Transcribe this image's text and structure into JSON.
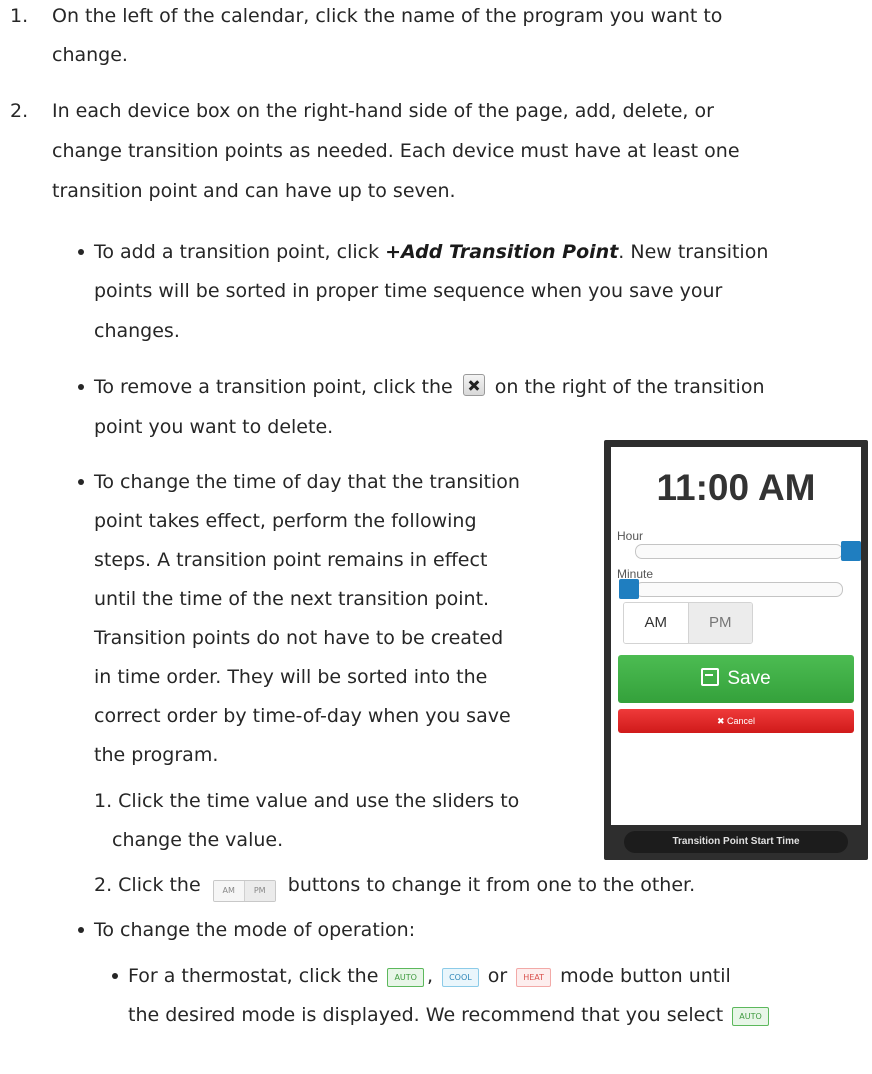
{
  "step1": {
    "number": "1.",
    "line1": "On the left of the calendar, click the name of the program you want to",
    "line2": "change."
  },
  "step2": {
    "number": "2.",
    "line1": "In each device box on the right-hand side of the page, add, delete, or",
    "line2": "change transition points as needed. Each device must have at least one",
    "line3": "transition point and can have up to seven."
  },
  "bullet_add": {
    "pre": "To add a transition point, click ",
    "emph": "+Add Transition Point",
    "post": ". New transition",
    "line2": "points will be sorted in proper time sequence when you save your",
    "line3": "changes."
  },
  "bullet_remove": {
    "pre": "To remove a transition point, click the",
    "post": "on the right of the transition",
    "line2": "point you want to delete."
  },
  "bullet_time": {
    "line1": "To change the time of day that the transition",
    "line2": "point takes effect, perform the following",
    "line3": "steps. A transition point remains in effect",
    "line4": "until the time of the next transition point.",
    "line5": "Transition points do not have to be created",
    "line6": "in time order. They will be sorted into the",
    "line7": "correct order by time-of-day when you save",
    "line8": "the program."
  },
  "substep1": {
    "line1": "1. Click the time value and use the sliders to",
    "line2": "change the value."
  },
  "substep2": {
    "pre": "2. Click the",
    "am": "AM",
    "pm": "PM",
    "post": "buttons to change it from one to the other."
  },
  "bullet_mode": {
    "line1": "To change the mode of operation:"
  },
  "bullet_thermostat": {
    "pre": "For a thermostat, click the",
    "comma": ",",
    "or": "or",
    "post": "mode button until",
    "line2": "the desired mode is displayed. We recommend that you select",
    "auto": "AUTO",
    "cool": "COOL",
    "heat": "HEAT"
  },
  "picker": {
    "time": "11:00 AM",
    "hour_label": "Hour",
    "minute_label": "Minute",
    "hour_level": 1.0,
    "minute_level": 0.0,
    "am": "AM",
    "pm": "PM",
    "save": "Save",
    "cancel": "✖ Cancel",
    "caption": "Transition Point Start Time"
  }
}
